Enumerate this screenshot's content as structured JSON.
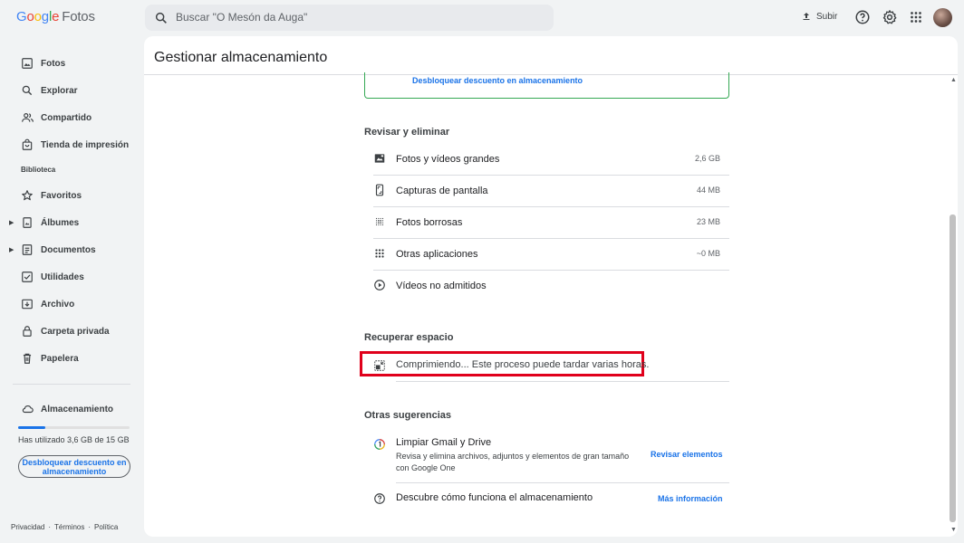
{
  "app": {
    "logo_google_letters": [
      "G",
      "o",
      "o",
      "g",
      "l",
      "e"
    ],
    "logo_product": "Fotos"
  },
  "search": {
    "placeholder": "Buscar \"O Mesón da Auga\""
  },
  "topbar": {
    "upload_label": "Subir",
    "icons": [
      "search-icon",
      "upload-icon",
      "help-icon",
      "settings-icon",
      "apps-grid-icon",
      "avatar"
    ]
  },
  "sidebar": {
    "items": [
      {
        "label": "Fotos",
        "icon": "photo-icon"
      },
      {
        "label": "Explorar",
        "icon": "search-icon"
      },
      {
        "label": "Compartido",
        "icon": "people-icon"
      },
      {
        "label": "Tienda de impresión",
        "icon": "shopping-bag-icon"
      }
    ],
    "library_label": "Biblioteca",
    "library_items": [
      {
        "label": "Favoritos",
        "icon": "star-icon"
      },
      {
        "label": "Álbumes",
        "icon": "album-icon",
        "expandable": true
      },
      {
        "label": "Documentos",
        "icon": "document-icon",
        "expandable": true
      },
      {
        "label": "Utilidades",
        "icon": "checkbox-icon"
      },
      {
        "label": "Archivo",
        "icon": "archive-icon"
      },
      {
        "label": "Carpeta privada",
        "icon": "lock-icon"
      },
      {
        "label": "Papelera",
        "icon": "trash-icon"
      }
    ],
    "storage_label": "Almacenamiento",
    "storage_used_fraction": 0.24,
    "storage_text": "Has utilizado 3,6 GB de 15 GB",
    "unlock_button_label": "Desbloquear descuento en almacenamiento",
    "footer_links": [
      "Privacidad",
      "·",
      "Términos",
      "·",
      "Política"
    ]
  },
  "main": {
    "title": "Gestionar almacenamiento",
    "promo_link": "Desbloquear descuento en almacenamiento",
    "review_title": "Revisar y eliminar",
    "review_items": [
      {
        "label": "Fotos y vídeos grandes",
        "size": "2,6 GB",
        "icon": "large-media-icon"
      },
      {
        "label": "Capturas de pantalla",
        "size": "44 MB",
        "icon": "phone-screenshot-icon"
      },
      {
        "label": "Fotos borrosas",
        "size": "23 MB",
        "icon": "blurry-icon"
      },
      {
        "label": "Otras aplicaciones",
        "size": "~0 MB",
        "icon": "apps-grid-icon"
      },
      {
        "label": "Vídeos no admitidos",
        "size": "",
        "icon": "play-circle-icon"
      }
    ],
    "recover_title": "Recuperar espacio",
    "compress_status": "Comprimiendo... Este proceso puede tardar varias horas.",
    "suggestions_title": "Otras sugerencias",
    "suggestion_gmail": {
      "title": "Limpiar Gmail y Drive",
      "description": "Revisa y elimina archivos, adjuntos y elementos de gran tamaño con Google One",
      "action": "Revisar elementos"
    },
    "suggestion_learn": {
      "title": "Descubre cómo funciona el almacenamiento",
      "action": "Más información"
    }
  },
  "colors": {
    "accent": "#1a73e8",
    "promo_border": "#34a853",
    "highlight_border": "#e0001b"
  }
}
